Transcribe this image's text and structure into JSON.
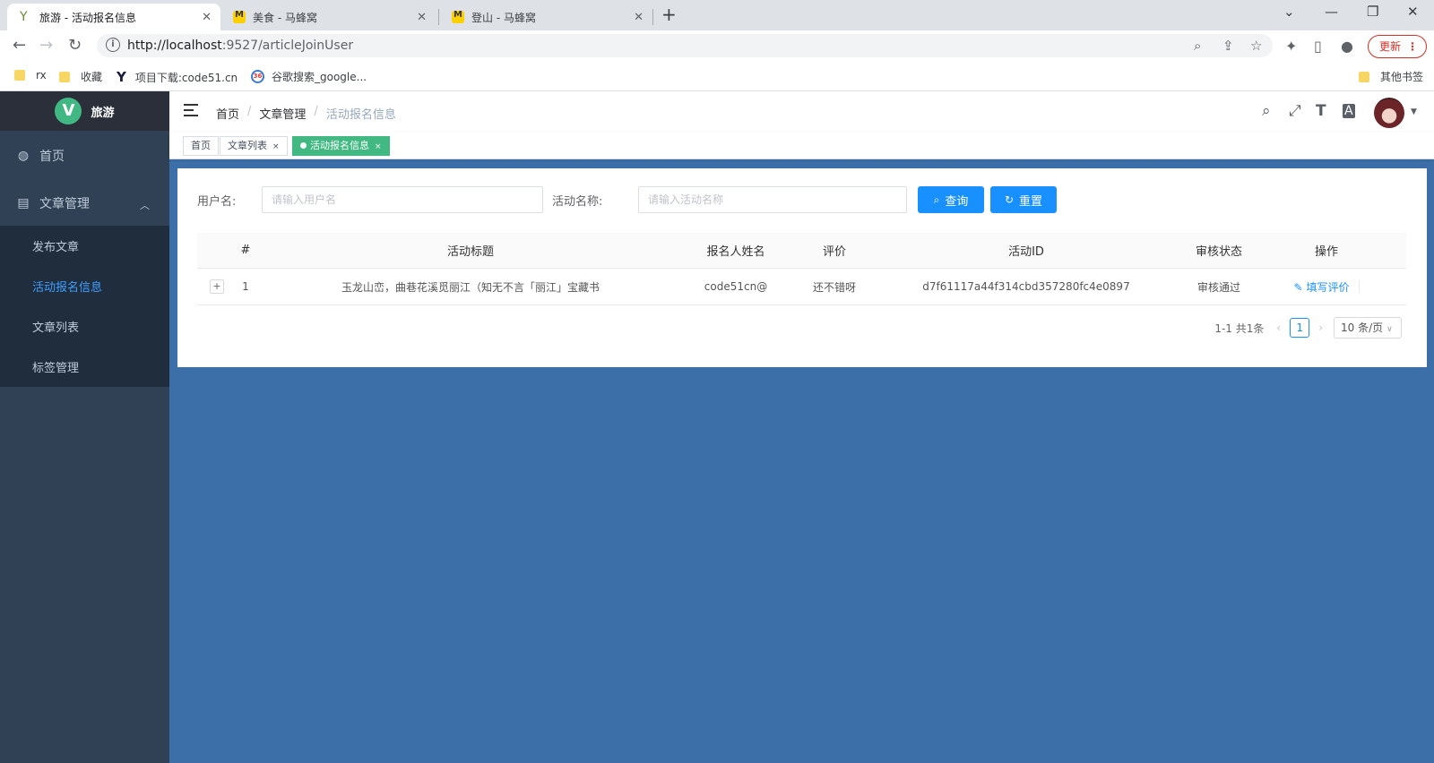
{
  "browser": {
    "tabs": [
      {
        "title": "旅游 - 活动报名信息",
        "active": true
      },
      {
        "title": "美食 - 马蜂窝",
        "active": false
      },
      {
        "title": "登山 - 马蜂窝",
        "active": false
      }
    ],
    "url_host": "http://localhost",
    "url_rest": ":9527/articleJoinUser",
    "update_label": "更新",
    "bookmarks": [
      {
        "label": "rx"
      },
      {
        "label": "收藏"
      },
      {
        "label": "项目下载:code51.cn"
      },
      {
        "label": "谷歌搜索_google..."
      },
      {
        "label": "其他书签"
      }
    ]
  },
  "sidebar": {
    "brand": "旅游",
    "logo_letter": "V",
    "items": [
      {
        "label": "首页"
      },
      {
        "label": "文章管理"
      }
    ],
    "submenu": [
      {
        "label": "发布文章"
      },
      {
        "label": "活动报名信息"
      },
      {
        "label": "文章列表"
      },
      {
        "label": "标签管理"
      }
    ]
  },
  "breadcrumb": [
    "首页",
    "文章管理",
    "活动报名信息"
  ],
  "tags": [
    {
      "label": "首页"
    },
    {
      "label": "文章列表"
    },
    {
      "label": "活动报名信息"
    }
  ],
  "search": {
    "username_label": "用户名:",
    "username_placeholder": "请输入用户名",
    "activity_label": "活动名称:",
    "activity_placeholder": "请输入活动名称",
    "query_label": "查询",
    "reset_label": "重置"
  },
  "table": {
    "columns": [
      "#",
      "活动标题",
      "报名人姓名",
      "评价",
      "活动ID",
      "审核状态",
      "操作"
    ],
    "rows": [
      {
        "index": "1",
        "title": "玉龙山峦，曲巷花溪觅丽江（知无不言「丽江」宝藏书",
        "name": "code51cn@",
        "review": "还不错呀",
        "id": "d7f61117a44f314cbd357280fc4e0897",
        "status": "审核通过",
        "action": "填写评价"
      }
    ]
  },
  "pagination": {
    "summary": "1-1 共1条",
    "current": "1",
    "page_size": "10 条/页"
  },
  "colors": {
    "sidebar_bg": "#304156",
    "primary": "#1890ff",
    "tag_active": "#42b983",
    "content_bg": "#3c6fa8"
  }
}
